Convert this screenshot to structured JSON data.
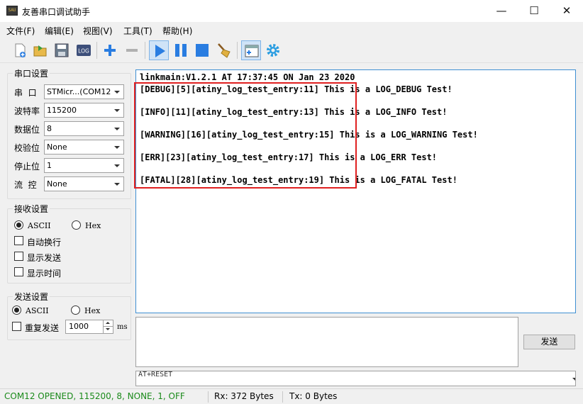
{
  "window": {
    "title": "友善串口调试助手",
    "icon_text": "SAU",
    "minimize": "—",
    "maximize": "☐",
    "close": "✕"
  },
  "menu": [
    "文件(F)",
    "编辑(E)",
    "视图(V)",
    "工具(T)",
    "帮助(H)"
  ],
  "toolbar": {
    "icons": [
      "new-file-icon",
      "open-folder-icon",
      "save-icon",
      "log-icon",
      "add-icon",
      "remove-icon",
      "play-icon",
      "pause-icon",
      "stop-icon",
      "clear-broom-icon",
      "new-window-icon",
      "settings-gear-icon"
    ],
    "log_label": "LOG"
  },
  "serial": {
    "title": "串口设置",
    "port_label": "串  口",
    "port_value": "STMicr...(COM12",
    "baud_label": "波特率",
    "baud_value": "115200",
    "databits_label": "数据位",
    "databits_value": "8",
    "parity_label": "校验位",
    "parity_value": "None",
    "stopbits_label": "停止位",
    "stopbits_value": "1",
    "flow_label": "流  控",
    "flow_value": "None"
  },
  "receive": {
    "title": "接收设置",
    "ascii": "ASCII",
    "hex": "Hex",
    "auto_wrap": "自动换行",
    "show_send": "显示发送",
    "show_time": "显示时间"
  },
  "send": {
    "title": "发送设置",
    "ascii": "ASCII",
    "hex": "Hex",
    "repeat": "重复发送",
    "interval": "1000",
    "unit": "ms",
    "button": "发送",
    "command": "AT+RESET"
  },
  "output": [
    "linkmain:V1.2.1 AT 17:37:45 ON Jan 23 2020",
    "[DEBUG][5][atiny_log_test_entry:11] This is a LOG_DEBUG Test!",
    "[INFO][11][atiny_log_test_entry:13] This is a LOG_INFO Test!",
    "[WARNING][16][atiny_log_test_entry:15] This is a LOG_WARNING Test!",
    "[ERR][23][atiny_log_test_entry:17] This is a LOG_ERR Test!",
    "[FATAL][28][atiny_log_test_entry:19] This is a LOG_FATAL Test!"
  ],
  "status": {
    "connection": "COM12 OPENED, 115200, 8, NONE, 1, OFF",
    "rx": "Rx: 372 Bytes",
    "tx": "Tx: 0 Bytes",
    "connection_color": "#1a8a1a"
  }
}
